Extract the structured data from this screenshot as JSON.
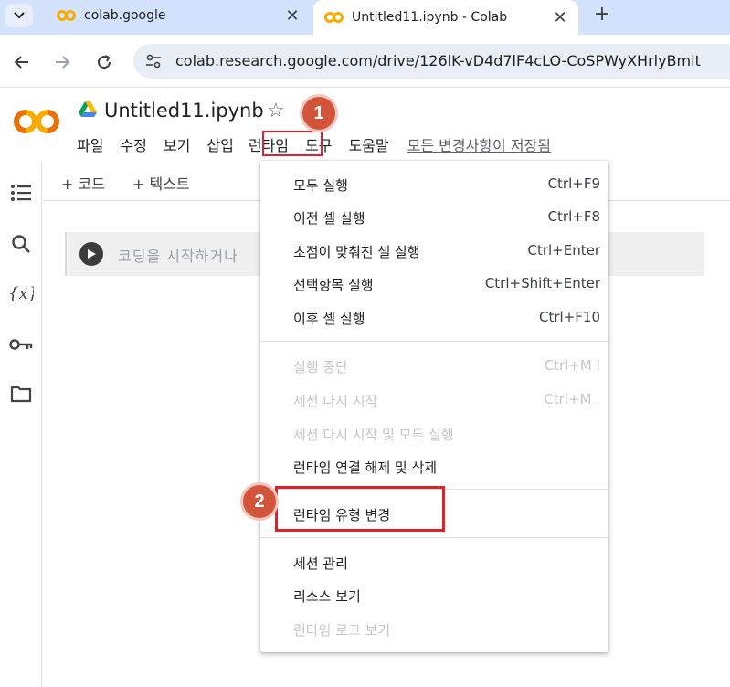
{
  "browser": {
    "tabs": [
      {
        "title": "colab.google",
        "active": false
      },
      {
        "title": "Untitled11.ipynb - Colab",
        "active": true
      }
    ],
    "close_glyph": "✕",
    "new_tab_glyph": "+",
    "url": "colab.research.google.com/drive/126lK-vD4d7lF4cLO-CoSPWyXHrlyBmit"
  },
  "colab": {
    "logo_text": "CO",
    "notebook_title": "Untitled11.ipynb",
    "star_glyph": "☆",
    "menu": [
      "파일",
      "수정",
      "보기",
      "삽입",
      "런타임",
      "도구",
      "도움말"
    ],
    "saved_status": "모든 변경사항이 저장됨",
    "add_code": "+ 코드",
    "add_text": "+ 텍스트",
    "cell_placeholder": "코딩을 시작하거나"
  },
  "callouts": {
    "one": "1",
    "two": "2"
  },
  "dropdown": {
    "items": [
      {
        "label": "모두 실행",
        "shortcut": "Ctrl+F9",
        "enabled": true
      },
      {
        "label": "이전 셀 실행",
        "shortcut": "Ctrl+F8",
        "enabled": true
      },
      {
        "label": "초점이 맞춰진 셀 실행",
        "shortcut": "Ctrl+Enter",
        "enabled": true
      },
      {
        "label": "선택항목 실행",
        "shortcut": "Ctrl+Shift+Enter",
        "enabled": true
      },
      {
        "label": "이후 셀 실행",
        "shortcut": "Ctrl+F10",
        "enabled": true
      },
      {
        "label": "실행 중단",
        "shortcut": "Ctrl+M I",
        "enabled": false
      },
      {
        "label": "세션 다시 시작",
        "shortcut": "Ctrl+M .",
        "enabled": false
      },
      {
        "label": "세션 다시 시작 및 모두 실행",
        "shortcut": "",
        "enabled": false
      },
      {
        "label": "런타임 연결 해제 및 삭제",
        "shortcut": "",
        "enabled": true
      },
      {
        "label": "런타임 유형 변경",
        "shortcut": "",
        "enabled": true
      },
      {
        "label": "세션 관리",
        "shortcut": "",
        "enabled": true
      },
      {
        "label": "리소스 보기",
        "shortcut": "",
        "enabled": true
      },
      {
        "label": "런타임 로그 보기",
        "shortcut": "",
        "enabled": false
      }
    ]
  },
  "colors": {
    "accent_highlight": "#e0202a",
    "callout": "#d2553b",
    "colab_orange": "#f9ab00",
    "colab_dark_orange": "#e8710a"
  }
}
